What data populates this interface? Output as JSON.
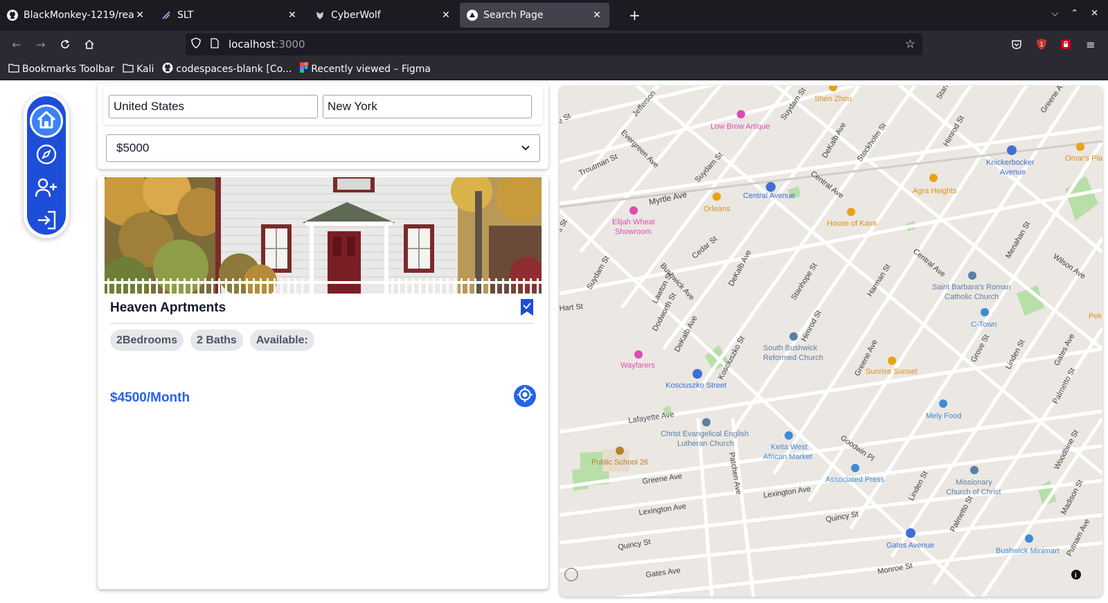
{
  "browser": {
    "tabs": [
      {
        "title": "BlackMonkey-1219/react-",
        "icon": "github-icon",
        "active": false
      },
      {
        "title": "SLT",
        "icon": "slt-icon",
        "active": false
      },
      {
        "title": "CyberWolf",
        "icon": "cyberwolf-icon",
        "active": false
      },
      {
        "title": "Search Page",
        "icon": "triangle-icon",
        "active": true
      }
    ],
    "url_host": "localhost",
    "url_port": ":3000",
    "bookmarks": [
      {
        "label": "Bookmarks Toolbar",
        "icon": "folder-icon"
      },
      {
        "label": "Kali",
        "icon": "folder-icon"
      },
      {
        "label": "codespaces-blank [Co...",
        "icon": "github-icon"
      },
      {
        "label": "Recently viewed – Figma",
        "icon": "figma-icon"
      }
    ]
  },
  "sidebar": {
    "items": [
      {
        "name": "home",
        "icon": "home-icon"
      },
      {
        "name": "explore",
        "icon": "compass-icon"
      },
      {
        "name": "add-user",
        "icon": "user-plus-icon"
      },
      {
        "name": "login",
        "icon": "login-icon"
      }
    ]
  },
  "search": {
    "country": "United States",
    "city": "New York",
    "price_selected": "$5000"
  },
  "listing": {
    "title": "Heaven Aprtments",
    "chips": [
      "2Bedrooms",
      "2 Baths",
      "Available:"
    ],
    "price": "$4500/Month"
  },
  "map": {
    "streets": [
      "Jefferson",
      "Suydam St",
      "Evergreen Ave",
      "Troutman St",
      "Myrtle Ave",
      "Central Ave",
      "DeKalb Ave",
      "Stockholm St",
      "Himrod St",
      "Stanhope St",
      "Harman St",
      "Bushwick Ave",
      "Cedar St",
      "Lawton St",
      "Dodworth St",
      "Kosciuszko St",
      "Hart St",
      "Greene Ave",
      "Grove St",
      "Linden St",
      "Gates Ave",
      "Palmetto St",
      "Woodbine St",
      "Madison St",
      "Putnam Ave",
      "Wilson Ave",
      "Menahan St",
      "Lafayette Ave",
      "Patchen Ave",
      "Lexington Ave",
      "Quincy St",
      "Goodwin Pl",
      "Monroe St",
      "Gates Ave"
    ],
    "places": [
      {
        "name": "Shen Zhou",
        "color": "#e8a317"
      },
      {
        "name": "Low Brow Artique",
        "color": "#d94db5"
      },
      {
        "name": "Central Avenue",
        "color": "#3f6fd6"
      },
      {
        "name": "Agra Heights",
        "color": "#e8a317"
      },
      {
        "name": "Knickerbocker Avenue",
        "color": "#3f6fd6"
      },
      {
        "name": "Omar's Pla",
        "color": "#e8a317"
      },
      {
        "name": "Orleans",
        "color": "#e8a317"
      },
      {
        "name": "Elijah Wheat Showroom",
        "color": "#d94db5"
      },
      {
        "name": "House of Kava",
        "color": "#e8a317"
      },
      {
        "name": "Saint Barbara's Roman Catholic Church",
        "color": "#5b7fa6"
      },
      {
        "name": "C-Town",
        "color": "#3f8bd6"
      },
      {
        "name": "Pek",
        "color": "#e8a317"
      },
      {
        "name": "South Bushwick Reformed Church",
        "color": "#5b7fa6"
      },
      {
        "name": "Sunrise Sunset",
        "color": "#e8a317"
      },
      {
        "name": "Wayfarers",
        "color": "#d94db5"
      },
      {
        "name": "Kosciuszko Street",
        "color": "#3f6fd6"
      },
      {
        "name": "Mely Food",
        "color": "#3f8bd6"
      },
      {
        "name": "Christ Evangelical English Lutheran Church",
        "color": "#5b7fa6"
      },
      {
        "name": "Keita West African Market",
        "color": "#3f8bd6"
      },
      {
        "name": "Public School 26",
        "color": "#b5822e"
      },
      {
        "name": "Associated Press",
        "color": "#3f8bd6"
      },
      {
        "name": "Missionary Church of Christ",
        "color": "#5b7fa6"
      },
      {
        "name": "Gates Avenue",
        "color": "#3f6fd6"
      },
      {
        "name": "Bushwick Minimart",
        "color": "#3f8bd6"
      }
    ]
  }
}
